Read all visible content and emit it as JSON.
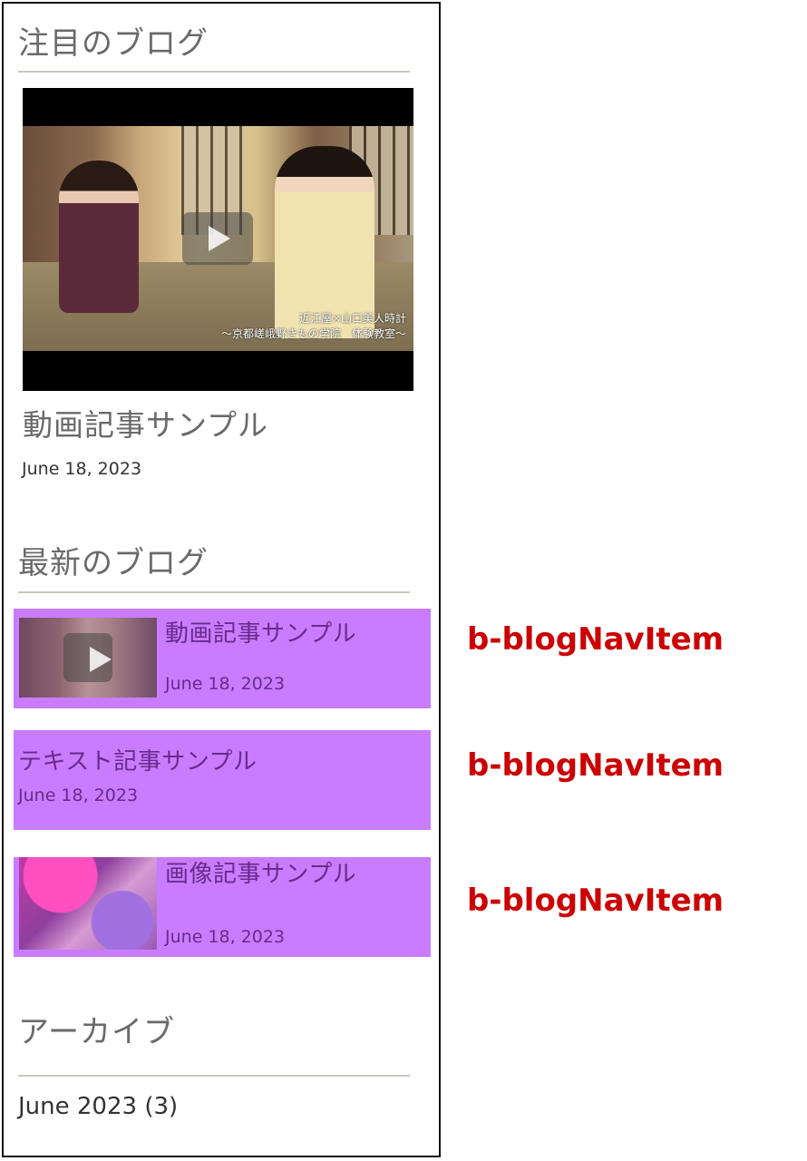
{
  "featured": {
    "heading": "注目のブログ",
    "video_caption_line1": "近江屋×山口美人時計",
    "video_caption_line2": "～京都嵯峨野きもの学院　体験教室～",
    "title": "動画記事サンプル",
    "date": "June 18, 2023"
  },
  "latest": {
    "heading": "最新のブログ",
    "items": [
      {
        "title": "動画記事サンプル",
        "date": "June 18, 2023",
        "annotation": "b-blogNavItem",
        "thumb": "video"
      },
      {
        "title": "テキスト記事サンプル",
        "date": "June 18, 2023",
        "annotation": "b-blogNavItem",
        "thumb": "none"
      },
      {
        "title": "画像記事サンプル",
        "date": "June 18, 2023",
        "annotation": "b-blogNavItem",
        "thumb": "image"
      }
    ]
  },
  "archive": {
    "heading": "アーカイブ",
    "items": [
      {
        "label": "June 2023 (3)"
      }
    ]
  },
  "colors": {
    "nav_item_highlight": "#c97cff",
    "annotation_text": "#cc0000",
    "heading_text": "#6a6a6a",
    "rule": "#c9c7bb"
  },
  "icons": {
    "play": "play-icon"
  }
}
